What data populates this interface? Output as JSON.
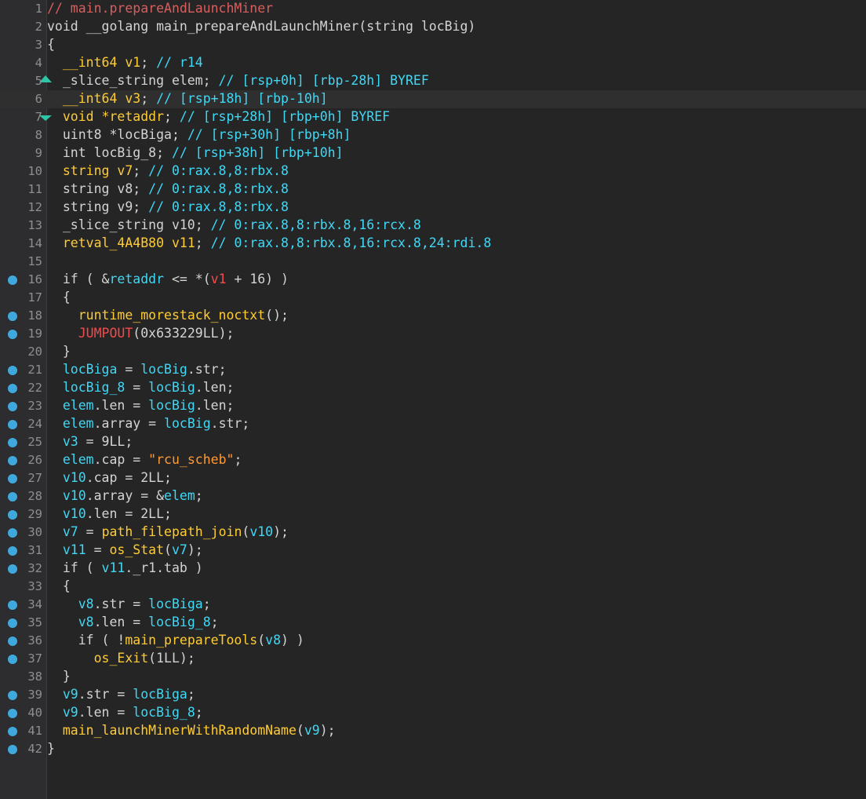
{
  "editor": {
    "lines": [
      {
        "num": "1",
        "bp": false,
        "tokens": [
          {
            "t": "// main.prepareAndLaunchMiner",
            "c": "comment"
          }
        ]
      },
      {
        "num": "2",
        "bp": false,
        "tokens": [
          {
            "t": "void __golang main_prepareAndLaunchMiner(string locBig)",
            "c": "default"
          }
        ]
      },
      {
        "num": "3",
        "bp": false,
        "tokens": [
          {
            "t": "{",
            "c": "default"
          }
        ]
      },
      {
        "num": "4",
        "bp": false,
        "tokens": [
          {
            "t": "  ",
            "c": "default"
          },
          {
            "t": "__int64 v1",
            "c": "yellow"
          },
          {
            "t": "; ",
            "c": "default"
          },
          {
            "t": "// r14",
            "c": "cyan"
          }
        ]
      },
      {
        "num": "5",
        "bp": false,
        "tokens": [
          {
            "t": "  _slice_string elem; ",
            "c": "default"
          },
          {
            "t": "// [rsp+0h] [rbp-28h] BYREF",
            "c": "cyan"
          }
        ]
      },
      {
        "num": "6",
        "bp": false,
        "tokens": [
          {
            "t": "  ",
            "c": "default"
          },
          {
            "t": "__int64 v3",
            "c": "yellow"
          },
          {
            "t": "; ",
            "c": "default"
          },
          {
            "t": "// [rsp+18h] [rbp-10h]",
            "c": "cyan"
          }
        ]
      },
      {
        "num": "7",
        "bp": false,
        "tokens": [
          {
            "t": "  ",
            "c": "default"
          },
          {
            "t": "void *retaddr",
            "c": "yellow"
          },
          {
            "t": "; ",
            "c": "default"
          },
          {
            "t": "// [rsp+28h] [rbp+0h] BYREF",
            "c": "cyan"
          }
        ]
      },
      {
        "num": "8",
        "bp": false,
        "tokens": [
          {
            "t": "  uint8 *locBiga; ",
            "c": "default"
          },
          {
            "t": "// [rsp+30h] [rbp+8h]",
            "c": "cyan"
          }
        ]
      },
      {
        "num": "9",
        "bp": false,
        "tokens": [
          {
            "t": "  int locBig_8; ",
            "c": "default"
          },
          {
            "t": "// [rsp+38h] [rbp+10h]",
            "c": "cyan"
          }
        ]
      },
      {
        "num": "10",
        "bp": false,
        "tokens": [
          {
            "t": "  ",
            "c": "default"
          },
          {
            "t": "string v7",
            "c": "yellow"
          },
          {
            "t": "; ",
            "c": "default"
          },
          {
            "t": "// 0:rax.8,8:rbx.8",
            "c": "cyan"
          }
        ]
      },
      {
        "num": "11",
        "bp": false,
        "tokens": [
          {
            "t": "  string v8; ",
            "c": "default"
          },
          {
            "t": "// 0:rax.8,8:rbx.8",
            "c": "cyan"
          }
        ]
      },
      {
        "num": "12",
        "bp": false,
        "tokens": [
          {
            "t": "  string v9; ",
            "c": "default"
          },
          {
            "t": "// 0:rax.8,8:rbx.8",
            "c": "cyan"
          }
        ]
      },
      {
        "num": "13",
        "bp": false,
        "tokens": [
          {
            "t": "  _slice_string v10; ",
            "c": "default"
          },
          {
            "t": "// 0:rax.8,8:rbx.8,16:rcx.8",
            "c": "cyan"
          }
        ]
      },
      {
        "num": "14",
        "bp": false,
        "tokens": [
          {
            "t": "  ",
            "c": "default"
          },
          {
            "t": "retval_4A4B80 v11",
            "c": "yellow"
          },
          {
            "t": "; ",
            "c": "default"
          },
          {
            "t": "// 0:rax.8,8:rbx.8,16:rcx.8,24:rdi.8",
            "c": "cyan"
          }
        ]
      },
      {
        "num": "15",
        "bp": false,
        "tokens": [
          {
            "t": "",
            "c": "default"
          }
        ]
      },
      {
        "num": "16",
        "bp": true,
        "tokens": [
          {
            "t": "  if ( &",
            "c": "default"
          },
          {
            "t": "retaddr",
            "c": "cyan"
          },
          {
            "t": " <= *(",
            "c": "default"
          },
          {
            "t": "v1",
            "c": "red"
          },
          {
            "t": " + 16) )",
            "c": "default"
          }
        ]
      },
      {
        "num": "17",
        "bp": false,
        "tokens": [
          {
            "t": "  {",
            "c": "default"
          }
        ]
      },
      {
        "num": "18",
        "bp": true,
        "tokens": [
          {
            "t": "    ",
            "c": "default"
          },
          {
            "t": "runtime_morestack_noctxt",
            "c": "yellow"
          },
          {
            "t": "();",
            "c": "default"
          }
        ]
      },
      {
        "num": "19",
        "bp": true,
        "tokens": [
          {
            "t": "    ",
            "c": "default"
          },
          {
            "t": "JUMPOUT",
            "c": "red"
          },
          {
            "t": "(0x633229LL);",
            "c": "default"
          }
        ]
      },
      {
        "num": "20",
        "bp": false,
        "tokens": [
          {
            "t": "  }",
            "c": "default"
          }
        ]
      },
      {
        "num": "21",
        "bp": true,
        "tokens": [
          {
            "t": "  ",
            "c": "default"
          },
          {
            "t": "locBiga",
            "c": "cyan"
          },
          {
            "t": " = ",
            "c": "default"
          },
          {
            "t": "locBig",
            "c": "cyan"
          },
          {
            "t": ".str;",
            "c": "default"
          }
        ]
      },
      {
        "num": "22",
        "bp": true,
        "tokens": [
          {
            "t": "  ",
            "c": "default"
          },
          {
            "t": "locBig_8",
            "c": "cyan"
          },
          {
            "t": " = ",
            "c": "default"
          },
          {
            "t": "locBig",
            "c": "cyan"
          },
          {
            "t": ".len;",
            "c": "default"
          }
        ]
      },
      {
        "num": "23",
        "bp": true,
        "tokens": [
          {
            "t": "  ",
            "c": "default"
          },
          {
            "t": "elem",
            "c": "cyan"
          },
          {
            "t": ".len = ",
            "c": "default"
          },
          {
            "t": "locBig",
            "c": "cyan"
          },
          {
            "t": ".len;",
            "c": "default"
          }
        ]
      },
      {
        "num": "24",
        "bp": true,
        "tokens": [
          {
            "t": "  ",
            "c": "default"
          },
          {
            "t": "elem",
            "c": "cyan"
          },
          {
            "t": ".array = ",
            "c": "default"
          },
          {
            "t": "locBig",
            "c": "cyan"
          },
          {
            "t": ".str;",
            "c": "default"
          }
        ]
      },
      {
        "num": "25",
        "bp": true,
        "tokens": [
          {
            "t": "  ",
            "c": "default"
          },
          {
            "t": "v3",
            "c": "cyan"
          },
          {
            "t": " = 9LL;",
            "c": "default"
          }
        ]
      },
      {
        "num": "26",
        "bp": true,
        "tokens": [
          {
            "t": "  ",
            "c": "default"
          },
          {
            "t": "elem",
            "c": "cyan"
          },
          {
            "t": ".cap = ",
            "c": "default"
          },
          {
            "t": "\"rcu_scheb\"",
            "c": "orange"
          },
          {
            "t": ";",
            "c": "default"
          }
        ]
      },
      {
        "num": "27",
        "bp": true,
        "tokens": [
          {
            "t": "  ",
            "c": "default"
          },
          {
            "t": "v10",
            "c": "cyan"
          },
          {
            "t": ".cap = 2LL;",
            "c": "default"
          }
        ]
      },
      {
        "num": "28",
        "bp": true,
        "tokens": [
          {
            "t": "  ",
            "c": "default"
          },
          {
            "t": "v10",
            "c": "cyan"
          },
          {
            "t": ".array = &",
            "c": "default"
          },
          {
            "t": "elem",
            "c": "cyan"
          },
          {
            "t": ";",
            "c": "default"
          }
        ]
      },
      {
        "num": "29",
        "bp": true,
        "tokens": [
          {
            "t": "  ",
            "c": "default"
          },
          {
            "t": "v10",
            "c": "cyan"
          },
          {
            "t": ".len = 2LL;",
            "c": "default"
          }
        ]
      },
      {
        "num": "30",
        "bp": true,
        "tokens": [
          {
            "t": "  ",
            "c": "default"
          },
          {
            "t": "v7",
            "c": "cyan"
          },
          {
            "t": " = ",
            "c": "default"
          },
          {
            "t": "path_filepath_join",
            "c": "yellow"
          },
          {
            "t": "(",
            "c": "default"
          },
          {
            "t": "v10",
            "c": "cyan"
          },
          {
            "t": ");",
            "c": "default"
          }
        ]
      },
      {
        "num": "31",
        "bp": true,
        "tokens": [
          {
            "t": "  ",
            "c": "default"
          },
          {
            "t": "v11",
            "c": "cyan"
          },
          {
            "t": " = ",
            "c": "default"
          },
          {
            "t": "os_Stat",
            "c": "yellow"
          },
          {
            "t": "(",
            "c": "default"
          },
          {
            "t": "v7",
            "c": "cyan"
          },
          {
            "t": ");",
            "c": "default"
          }
        ]
      },
      {
        "num": "32",
        "bp": true,
        "tokens": [
          {
            "t": "  if ( ",
            "c": "default"
          },
          {
            "t": "v11",
            "c": "cyan"
          },
          {
            "t": "._r1.tab )",
            "c": "default"
          }
        ]
      },
      {
        "num": "33",
        "bp": false,
        "tokens": [
          {
            "t": "  {",
            "c": "default"
          }
        ]
      },
      {
        "num": "34",
        "bp": true,
        "tokens": [
          {
            "t": "    ",
            "c": "default"
          },
          {
            "t": "v8",
            "c": "cyan"
          },
          {
            "t": ".str = ",
            "c": "default"
          },
          {
            "t": "locBiga",
            "c": "cyan"
          },
          {
            "t": ";",
            "c": "default"
          }
        ]
      },
      {
        "num": "35",
        "bp": true,
        "tokens": [
          {
            "t": "    ",
            "c": "default"
          },
          {
            "t": "v8",
            "c": "cyan"
          },
          {
            "t": ".len = ",
            "c": "default"
          },
          {
            "t": "locBig_8",
            "c": "cyan"
          },
          {
            "t": ";",
            "c": "default"
          }
        ]
      },
      {
        "num": "36",
        "bp": true,
        "tokens": [
          {
            "t": "    if ( !",
            "c": "default"
          },
          {
            "t": "main_prepareTools",
            "c": "yellow"
          },
          {
            "t": "(",
            "c": "default"
          },
          {
            "t": "v8",
            "c": "cyan"
          },
          {
            "t": ") )",
            "c": "default"
          }
        ]
      },
      {
        "num": "37",
        "bp": true,
        "tokens": [
          {
            "t": "      ",
            "c": "default"
          },
          {
            "t": "os_Exit",
            "c": "yellow"
          },
          {
            "t": "(1LL);",
            "c": "default"
          }
        ]
      },
      {
        "num": "38",
        "bp": false,
        "tokens": [
          {
            "t": "  }",
            "c": "default"
          }
        ]
      },
      {
        "num": "39",
        "bp": true,
        "tokens": [
          {
            "t": "  ",
            "c": "default"
          },
          {
            "t": "v9",
            "c": "cyan"
          },
          {
            "t": ".str = ",
            "c": "default"
          },
          {
            "t": "locBiga",
            "c": "cyan"
          },
          {
            "t": ";",
            "c": "default"
          }
        ]
      },
      {
        "num": "40",
        "bp": true,
        "tokens": [
          {
            "t": "  ",
            "c": "default"
          },
          {
            "t": "v9",
            "c": "cyan"
          },
          {
            "t": ".len = ",
            "c": "default"
          },
          {
            "t": "locBig_8",
            "c": "cyan"
          },
          {
            "t": ";",
            "c": "default"
          }
        ]
      },
      {
        "num": "41",
        "bp": true,
        "tokens": [
          {
            "t": "  ",
            "c": "default"
          },
          {
            "t": "main_launchMinerWithRandomName",
            "c": "yellow"
          },
          {
            "t": "(",
            "c": "default"
          },
          {
            "t": "v9",
            "c": "cyan"
          },
          {
            "t": ");",
            "c": "default"
          }
        ]
      },
      {
        "num": "42",
        "bp": true,
        "tokens": [
          {
            "t": "}",
            "c": "default"
          }
        ]
      }
    ]
  },
  "colors": {
    "background": "#252526",
    "gutter": "#2d2d2f",
    "comment": "#d95e5e",
    "identifier": "#3fd8f5",
    "function": "#ffcc33",
    "string": "#ff9933",
    "breakpoint": "#3fa9de"
  }
}
